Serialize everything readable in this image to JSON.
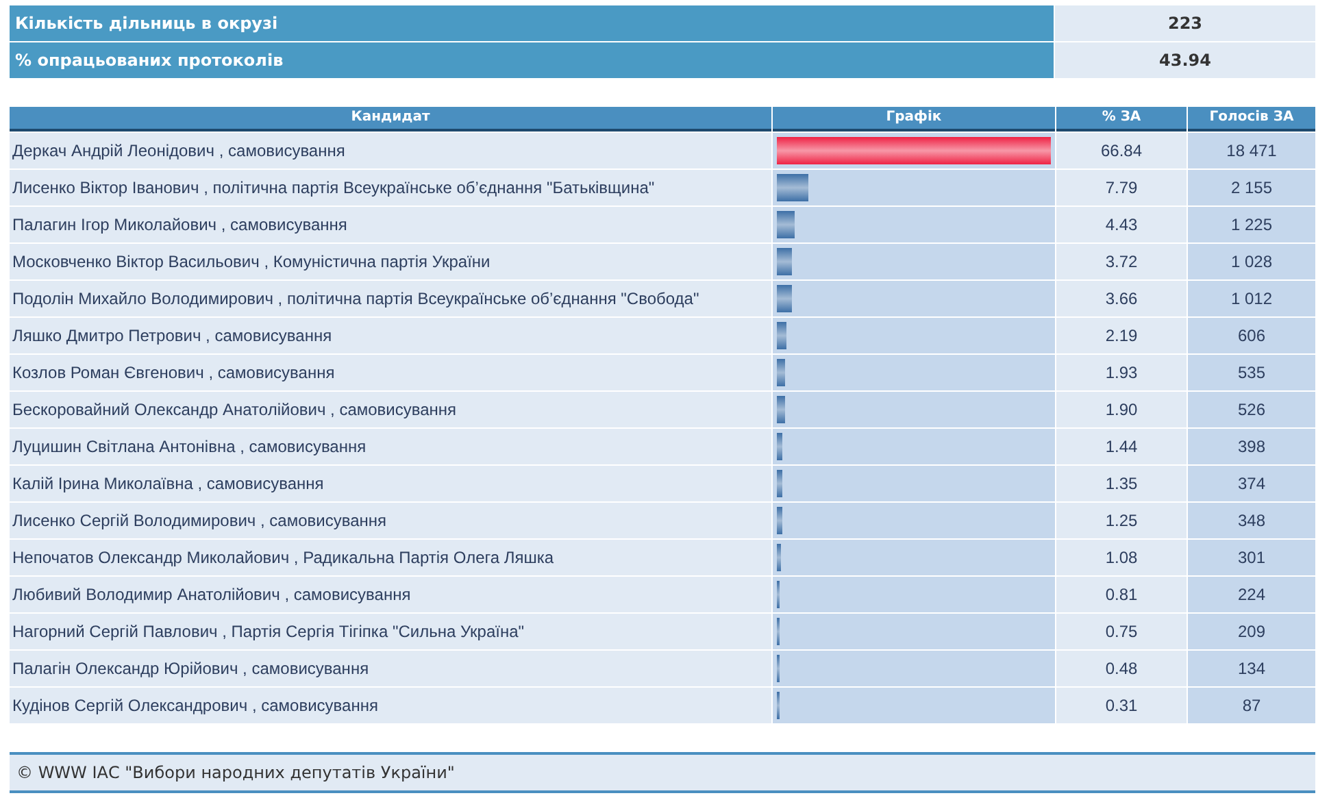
{
  "summary": [
    {
      "label": "Кількість дільниць в окрузі",
      "value": "223"
    },
    {
      "label": "% опрацьованих протоколів",
      "value": "43.94"
    }
  ],
  "table": {
    "columns": [
      "Кандидат",
      "Графік",
      "% ЗА",
      "Голосів ЗА"
    ],
    "rows": [
      {
        "candidate": "Деркач Андрій Леонідович , самовисування",
        "level": 1,
        "color": "#ee2244",
        "percent": "66.84",
        "votes": "18 471"
      },
      {
        "candidate": "Лисенко Віктор Іванович , політична партія Всеукраїнське об’єднання \"Батьківщина\"",
        "level": 0.117,
        "color": "#3d6fa6",
        "percent": "7.79",
        "votes": "2 155"
      },
      {
        "candidate": "Палагин Ігор Миколайович , самовисування",
        "level": 0.066,
        "color": "#3d6fa6",
        "percent": "4.43",
        "votes": "1 225"
      },
      {
        "candidate": "Московченко Віктор Васильович , Комуністична партія України",
        "level": 0.056,
        "color": "#3d6fa6",
        "percent": "3.72",
        "votes": "1 028"
      },
      {
        "candidate": "Подолін Михайло Володимирович , політична партія Всеукраїнське об’єднання \"Свобода\"",
        "level": 0.055,
        "color": "#3d6fa6",
        "percent": "3.66",
        "votes": "1 012"
      },
      {
        "candidate": "Ляшко Дмитро Петрович , самовисування",
        "level": 0.033,
        "color": "#3d6fa6",
        "percent": "2.19",
        "votes": "606"
      },
      {
        "candidate": "Козлов Роман Євгенович , самовисування",
        "level": 0.029,
        "color": "#3d6fa6",
        "percent": "1.93",
        "votes": "535"
      },
      {
        "candidate": "Бескоровайний Олександр Анатолійович , самовисування",
        "level": 0.028,
        "color": "#3d6fa6",
        "percent": "1.90",
        "votes": "526"
      },
      {
        "candidate": "Луцишин Світлана Антонівна , самовисування",
        "level": 0.022,
        "color": "#3d6fa6",
        "percent": "1.44",
        "votes": "398"
      },
      {
        "candidate": "Калій Ірина Миколаївна , самовисування",
        "level": 0.02,
        "color": "#3d6fa6",
        "percent": "1.35",
        "votes": "374"
      },
      {
        "candidate": "Лисенко Сергій Володимирович , самовисування",
        "level": 0.019,
        "color": "#3d6fa6",
        "percent": "1.25",
        "votes": "348"
      },
      {
        "candidate": "Непочатов Олександр Миколайович , Радикальна Партія Олега Ляшка",
        "level": 0.016,
        "color": "#3d6fa6",
        "percent": "1.08",
        "votes": "301"
      },
      {
        "candidate": "Любивий Володимир Анатолійович , самовисування",
        "level": 0.012,
        "color": "#3d6fa6",
        "percent": "0.81",
        "votes": "224"
      },
      {
        "candidate": "Нагорний Сергій Павлович , Партія Сергія Тігіпка \"Сильна Україна\"",
        "level": 0.011,
        "color": "#3d6fa6",
        "percent": "0.75",
        "votes": "209"
      },
      {
        "candidate": "Палагін Олександр Юрійович , самовисування",
        "level": 0.007,
        "color": "#3d6fa6",
        "percent": "0.48",
        "votes": "134"
      },
      {
        "candidate": "Кудінов Сергій Олександрович , самовисування",
        "level": 0.005,
        "color": "#3d6fa6",
        "percent": "0.31",
        "votes": "87"
      }
    ]
  },
  "footer": "© WWW ІАС \"Вибори народних депутатів України\""
}
